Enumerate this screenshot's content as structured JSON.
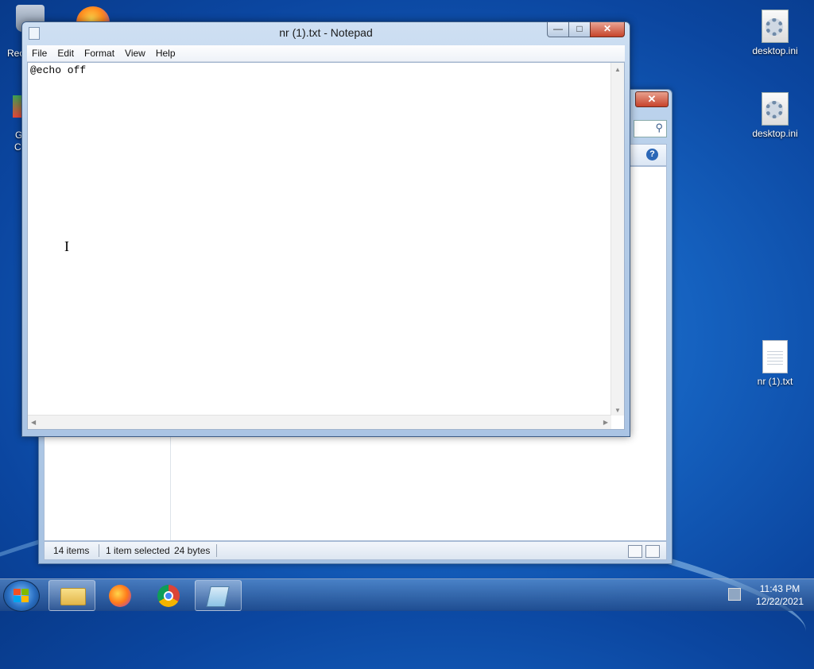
{
  "notepad": {
    "title": "nr (1).txt - Notepad",
    "menu": [
      "File",
      "Edit",
      "Format",
      "View",
      "Help"
    ],
    "content": "@echo off",
    "buttons": {
      "minimize": "—",
      "maximize": "□",
      "close": "✕"
    }
  },
  "explorer": {
    "close": "✕",
    "status": {
      "items": "14 items",
      "selected": "1 item selected",
      "size": "24 bytes"
    }
  },
  "desktop": {
    "icons": [
      {
        "label": "desktop.ini"
      },
      {
        "label": "desktop.ini"
      },
      {
        "label": "nr (1).txt"
      }
    ],
    "left_partial": [
      "Rec",
      "G",
      "C"
    ]
  },
  "taskbar": {
    "time": "11:43 PM",
    "date": "12/22/2021",
    "apps": [
      "windows-explorer",
      "firefox",
      "chrome",
      "notepad"
    ]
  },
  "colors": {
    "desktop": "#1561bf",
    "close_button": "#c7432b",
    "window_frame": "#b6cde8"
  }
}
